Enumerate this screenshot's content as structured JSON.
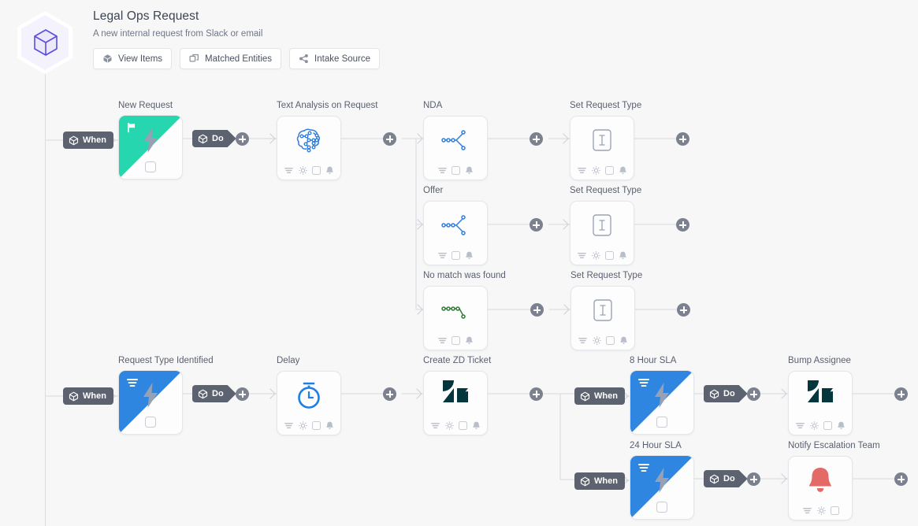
{
  "header": {
    "title": "Legal Ops Request",
    "subtitle": "A new internal request from Slack or email",
    "logo_icon": "cube-icon",
    "buttons": [
      {
        "label": "View Items",
        "icon": "cube-icon"
      },
      {
        "label": "Matched Entities",
        "icon": "layers-icon"
      },
      {
        "label": "Intake Source",
        "icon": "node-share-icon"
      }
    ]
  },
  "connector_labels": {
    "when": "When",
    "do": "Do",
    "add": "+"
  },
  "colors": {
    "canvas": "#f7f7f7",
    "pill": "#5c6270",
    "plus": "#7b818e",
    "wire": "#dcdee3",
    "trigger_teal": "#25d6ae",
    "trigger_blue": "#2f86e0",
    "brand_purple": "#5b4ede",
    "icon_blue": "#2f7fe0",
    "icon_green": "#2e7d32",
    "zendesk": "#03363d",
    "bell_red": "#e36a66",
    "bolt_gray": "#98a0b3"
  },
  "flows": [
    {
      "name": "new-request-flow",
      "trigger": {
        "label": "New Request",
        "corner": "teal",
        "corner_icon": "flag-icon",
        "glyph": "bolt-icon"
      },
      "nodes": [
        {
          "label": "Text Analysis on Request",
          "glyph": "brain-network-icon",
          "glyph_color": "icon_blue",
          "footer": [
            "filter-icon",
            "gear-icon",
            "checkbox-icon",
            "bell-icon"
          ]
        },
        {
          "label": "NDA",
          "glyph": "branch-node-icon",
          "glyph_color": "icon_blue",
          "footer": [
            "filter-icon",
            "checkbox-icon",
            "bell-icon"
          ]
        },
        {
          "label": "Set Request Type",
          "glyph": "text-input-icon",
          "glyph_color": "gray",
          "footer": [
            "filter-icon",
            "gear-icon",
            "checkbox-icon",
            "bell-icon"
          ]
        },
        {
          "label": "Offer",
          "glyph": "branch-node-icon",
          "glyph_color": "icon_blue",
          "footer": [
            "filter-icon",
            "checkbox-icon",
            "bell-icon"
          ]
        },
        {
          "label": "Set Request Type",
          "glyph": "text-input-icon",
          "glyph_color": "gray",
          "footer": [
            "filter-icon",
            "gear-icon",
            "checkbox-icon",
            "bell-icon"
          ]
        },
        {
          "label": "No match was found",
          "glyph": "branch-node-icon",
          "glyph_color": "icon_green",
          "footer": [
            "filter-icon",
            "checkbox-icon",
            "bell-icon"
          ]
        },
        {
          "label": "Set Request Type",
          "glyph": "text-input-icon",
          "glyph_color": "gray",
          "footer": [
            "filter-icon",
            "gear-icon",
            "checkbox-icon",
            "bell-icon"
          ]
        }
      ]
    },
    {
      "name": "request-type-identified-flow",
      "trigger": {
        "label": "Request Type Identified",
        "corner": "blue",
        "corner_icon": "filter-icon",
        "glyph": "bolt-icon"
      },
      "nodes": [
        {
          "label": "Delay",
          "glyph": "stopwatch-icon",
          "glyph_color": "icon_blue",
          "footer": [
            "filter-icon",
            "gear-icon",
            "checkbox-icon",
            "bell-icon"
          ]
        },
        {
          "label": "Create ZD Ticket",
          "glyph": "zendesk-icon",
          "glyph_color": "zendesk",
          "footer": [
            "filter-icon",
            "gear-icon",
            "checkbox-icon",
            "bell-icon"
          ]
        }
      ]
    },
    {
      "name": "sla-flows",
      "triggers": [
        {
          "label": "8 Hour SLA",
          "corner": "blue",
          "corner_icon": "filter-icon",
          "glyph": "bolt-icon"
        },
        {
          "label": "24 Hour SLA",
          "corner": "blue",
          "corner_icon": "filter-icon",
          "glyph": "bolt-icon"
        }
      ],
      "nodes": [
        {
          "label": "Bump Assignee",
          "glyph": "zendesk-icon",
          "glyph_color": "zendesk",
          "footer": [
            "filter-icon",
            "gear-icon",
            "checkbox-icon",
            "bell-icon"
          ]
        },
        {
          "label": "Notify Escalation Team",
          "glyph": "bell-alert-icon",
          "glyph_color": "bell_red",
          "footer": [
            "filter-icon",
            "gear-icon",
            "checkbox-icon"
          ]
        }
      ]
    }
  ]
}
